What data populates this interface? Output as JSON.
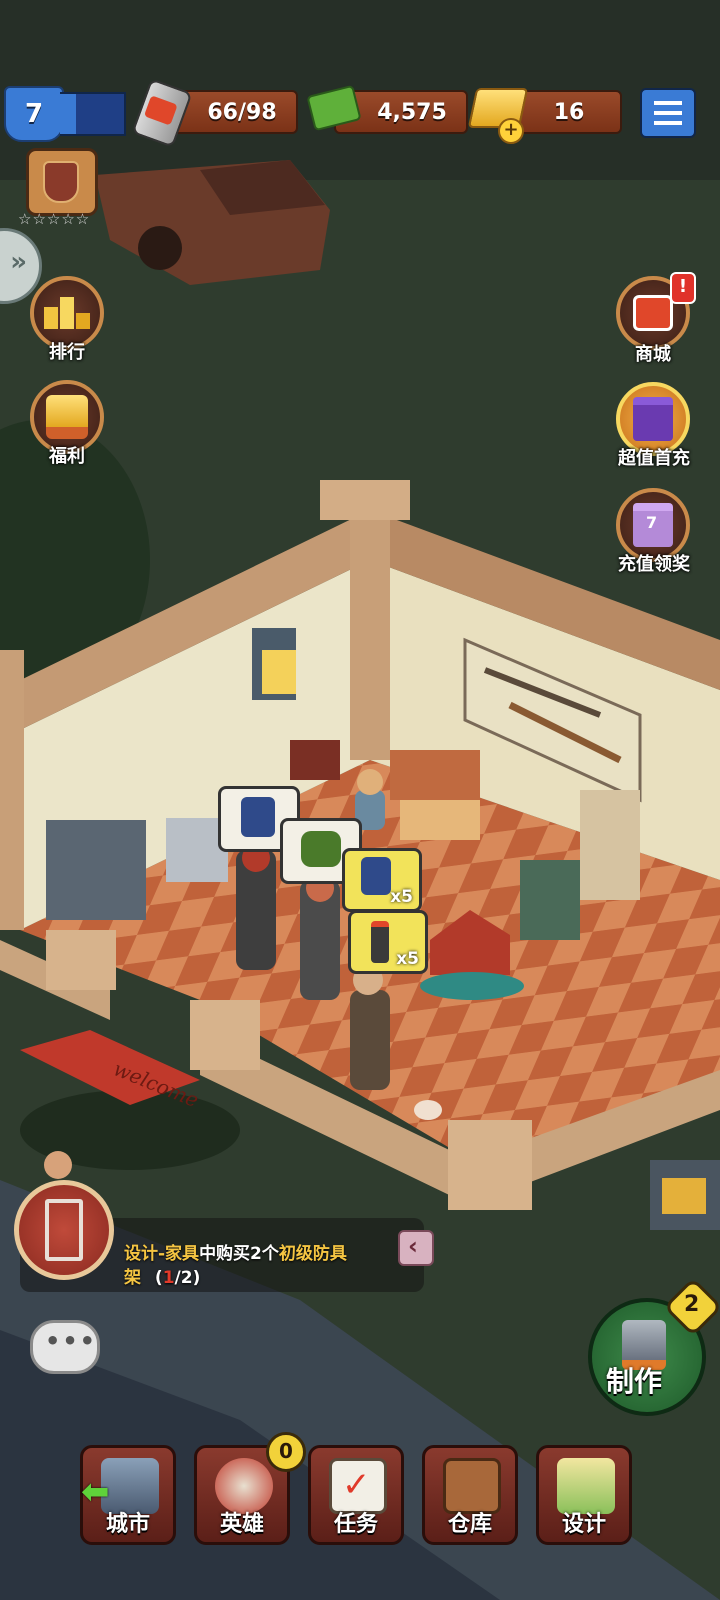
{
  "hud": {
    "level": "7",
    "energy": "66/98",
    "cash": "4,575",
    "gold": "16",
    "stars": "☆☆☆☆☆"
  },
  "left_menu": [
    {
      "label": "排行"
    },
    {
      "label": "福利"
    }
  ],
  "right_menu": [
    {
      "label": "商城",
      "badge": "!"
    },
    {
      "label": "超值首充"
    },
    {
      "label": "充值领奖",
      "badge": "7"
    }
  ],
  "scene": {
    "doormat_text": "welcome",
    "bubbles": [
      {
        "count": ""
      },
      {
        "count": ""
      },
      {
        "count": "x5"
      },
      {
        "count": "x5"
      }
    ]
  },
  "quest": {
    "prefix": "设计-家具",
    "middle": "中购买2个",
    "highlight": "初级防具",
    "line2": "架",
    "progress_open": "(",
    "progress_done": "1",
    "progress_rest": "/2)"
  },
  "craft": {
    "label": "制作",
    "badge": "2"
  },
  "bottom_nav": [
    {
      "label": "城市"
    },
    {
      "label": "英雄",
      "badge": "0"
    },
    {
      "label": "任务"
    },
    {
      "label": "仓库"
    },
    {
      "label": "设计"
    }
  ],
  "colors": {
    "quest_yellow": "#f5c542",
    "quest_red": "#e03a2a",
    "accent_blue": "#3a7bd5"
  }
}
